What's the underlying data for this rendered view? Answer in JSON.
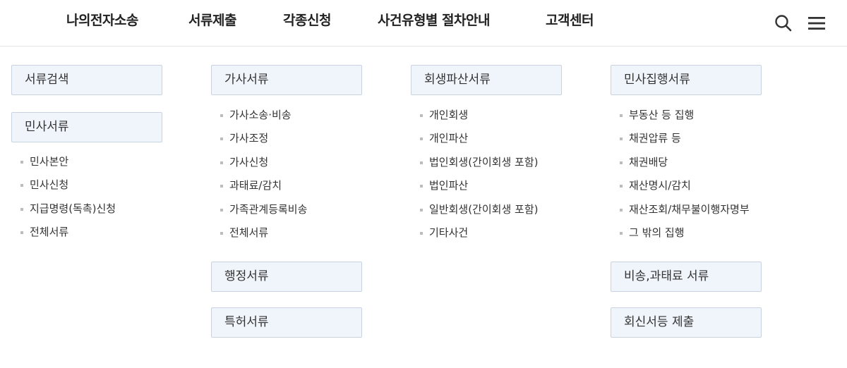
{
  "header": {
    "nav": [
      "나의전자소송",
      "서류제출",
      "각종신청",
      "사건유형별 절차안내",
      "고객센터"
    ],
    "icons": {
      "search": "search-icon",
      "menu": "hamburger-menu-icon"
    }
  },
  "menu": {
    "col1": {
      "search_label": "서류검색",
      "civil": {
        "title": "민사서류",
        "items": [
          "민사본안",
          "민사신청",
          "지급명령(독촉)신청",
          "전체서류"
        ]
      }
    },
    "col2": {
      "family": {
        "title": "가사서류",
        "items": [
          "가사소송·비송",
          "가사조정",
          "가사신청",
          "과태료/감치",
          "가족관계등록비송",
          "전체서류"
        ]
      },
      "admin": {
        "title": "행정서류"
      },
      "patent": {
        "title": "특허서류"
      }
    },
    "col3": {
      "rehab": {
        "title": "회생파산서류",
        "items": [
          "개인회생",
          "개인파산",
          "법인회생(간이회생 포함)",
          "법인파산",
          "일반회생(간이회생 포함)",
          "기타사건"
        ]
      }
    },
    "col4": {
      "exec": {
        "title": "민사집행서류",
        "items": [
          "부동산 등 집행",
          "채권압류 등",
          "채권배당",
          "재산명시/감치",
          "재산조회/채무불이행자명부",
          "그 밖의 집행"
        ]
      },
      "nonlit": {
        "title": "비송,과태료 서류"
      },
      "reply": {
        "title": "회신서등 제출"
      }
    }
  },
  "colors": {
    "category_bg": "#f0f5fb",
    "category_border": "#c9d3df",
    "bullet": "#bcbcbc"
  }
}
